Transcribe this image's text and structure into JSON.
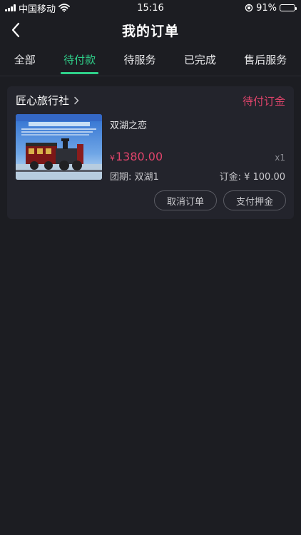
{
  "status_bar": {
    "carrier": "中国移动",
    "time": "15:16",
    "battery": "91%",
    "battery_level": 0.91
  },
  "nav": {
    "title": "我的订单",
    "back_icon": "chevron-left-icon"
  },
  "tabs": [
    {
      "label": "全部",
      "active": false
    },
    {
      "label": "待付款",
      "active": true
    },
    {
      "label": "待服务",
      "active": false
    },
    {
      "label": "已完成",
      "active": false
    },
    {
      "label": "售后服务",
      "active": false
    }
  ],
  "order": {
    "shop_name": "匠心旅行社",
    "status": "待付订金",
    "product_name": "双湖之恋",
    "currency": "¥",
    "price": "1380.00",
    "quantity": "x1",
    "group": "团期: 双湖1",
    "deposit": "订金: ¥ 100.00",
    "cancel_label": "取消订单",
    "pay_label": "支付押金"
  },
  "colors": {
    "accent": "#2fd08a",
    "price": "#e0446b",
    "background": "#1c1d22",
    "card": "#23242c"
  }
}
